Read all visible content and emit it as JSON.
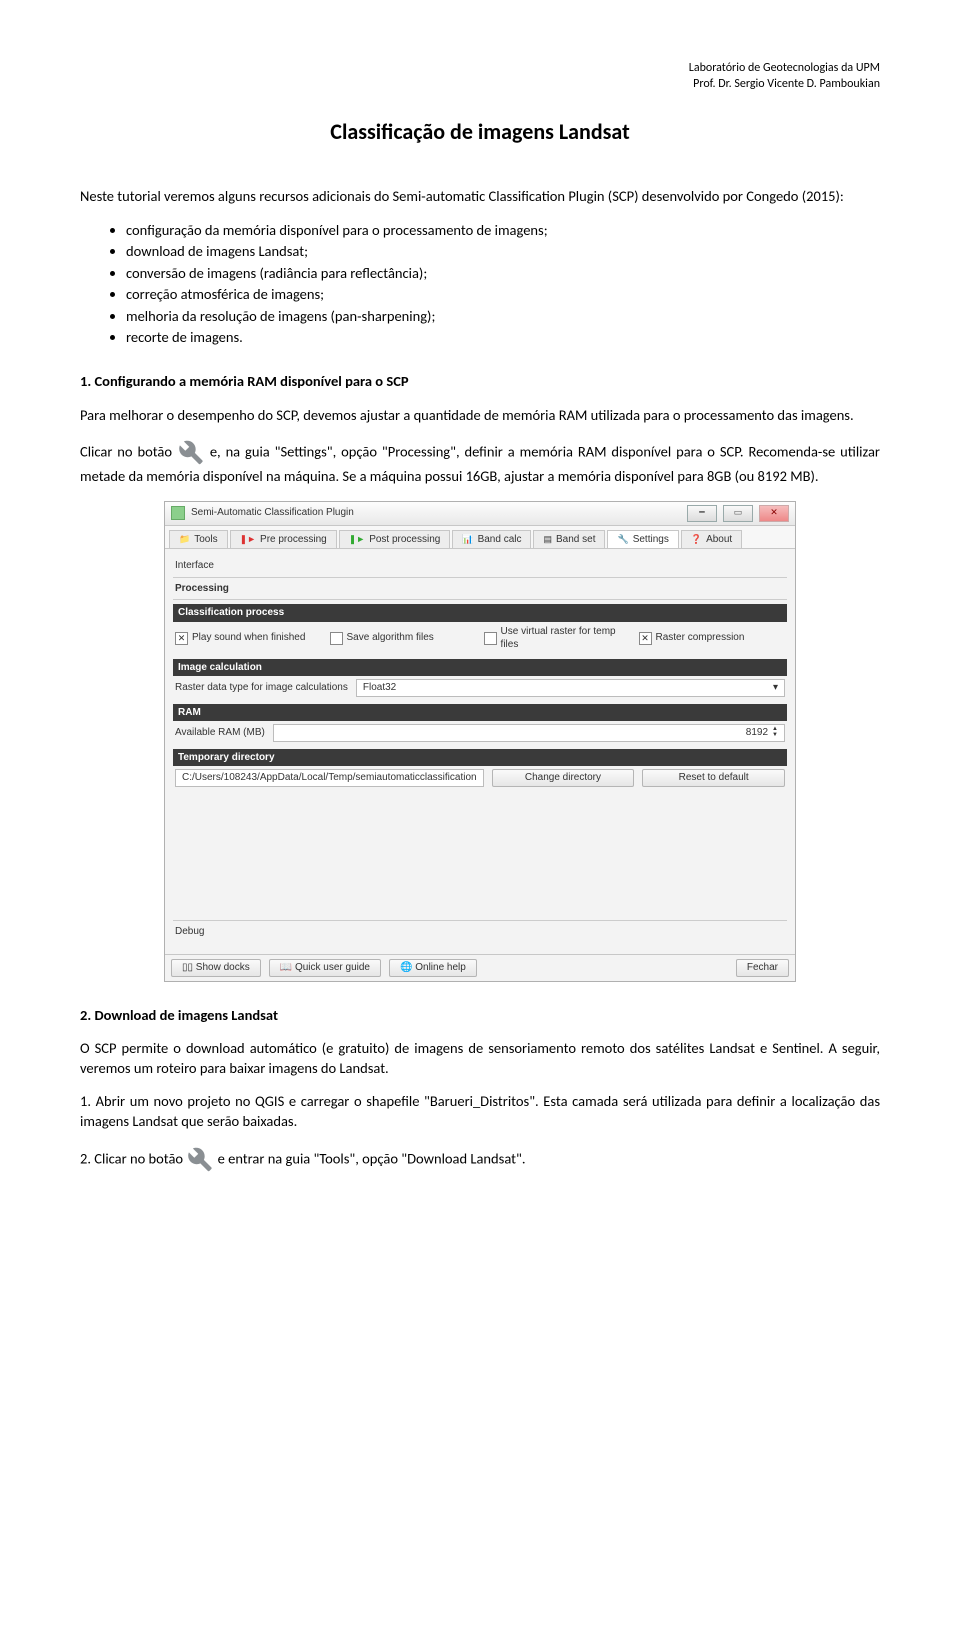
{
  "header": {
    "line1": "Laboratório de Geotecnologias da UPM",
    "line2": "Prof. Dr. Sergio Vicente D. Pamboukian"
  },
  "title": "Classificação de imagens Landsat",
  "intro": "Neste tutorial veremos alguns recursos adicionais do Semi-automatic Classification Plugin (SCP) desenvolvido por Congedo (2015):",
  "bullets": [
    "configuração da memória disponível para o processamento de imagens;",
    "download de imagens Landsat;",
    "conversão de imagens (radiância para reflectância);",
    "correção atmosférica de imagens;",
    "melhoria da resolução de imagens (pan-sharpening);",
    "recorte de imagens."
  ],
  "sec1": {
    "title": "1. Configurando a memória RAM disponível para o SCP",
    "p1": "Para melhorar o desempenho do SCP, devemos ajustar a quantidade de memória RAM utilizada para o processamento das imagens.",
    "p2_pre": "Clicar no botão ",
    "p2_post": " e, na guia \"Settings\", opção \"Processing\", definir a memória RAM disponível para o SCP. Recomenda-se utilizar metade da memória disponível na máquina. Se a máquina possui 16GB, ajustar a memória disponível para 8GB (ou 8192 MB)."
  },
  "screenshot": {
    "window_title": "Semi-Automatic Classification Plugin",
    "tabs": [
      "Tools",
      "Pre processing",
      "Post processing",
      "Band calc",
      "Band set",
      "Settings",
      "About"
    ],
    "active_tab": "Settings",
    "group1": "Interface",
    "group2": "Processing",
    "bar_classproc": "Classification process",
    "cb_playsound": "Play sound when finished",
    "cb_savealg": "Save algorithm files",
    "cb_virtraster": "Use virtual raster for temp files",
    "cb_rastercomp": "Raster compression",
    "bar_imgcalc": "Image calculation",
    "raster_dtype_lbl": "Raster data type for image calculations",
    "raster_dtype_val": "Float32",
    "bar_ram": "RAM",
    "ram_lbl": "Available RAM (MB)",
    "ram_val": "8192",
    "bar_tempdir": "Temporary directory",
    "tempdir_val": "C:/Users/108243/AppData/Local/Temp/semiautomaticclassification",
    "btn_changedir": "Change directory",
    "btn_resetdef": "Reset to default",
    "debug": "Debug",
    "foot_showdocks": "Show docks",
    "foot_quickguide": "Quick user guide",
    "foot_onlinehelp": "Online help",
    "foot_fechar": "Fechar"
  },
  "sec2": {
    "title": "2. Download de imagens Landsat",
    "p1": "O SCP permite o download automático (e gratuito) de imagens de sensoriamento remoto dos satélites Landsat e Sentinel. A seguir, veremos um roteiro para baixar imagens do Landsat.",
    "p2": "1. Abrir um novo projeto no QGIS e carregar o shapefile \"Barueri_Distritos\". Esta camada será utilizada para definir a localização das imagens Landsat que serão baixadas.",
    "p3_pre": "2. Clicar no botão ",
    "p3_post": " e entrar na guia \"Tools\", opção \"Download Landsat\"."
  }
}
